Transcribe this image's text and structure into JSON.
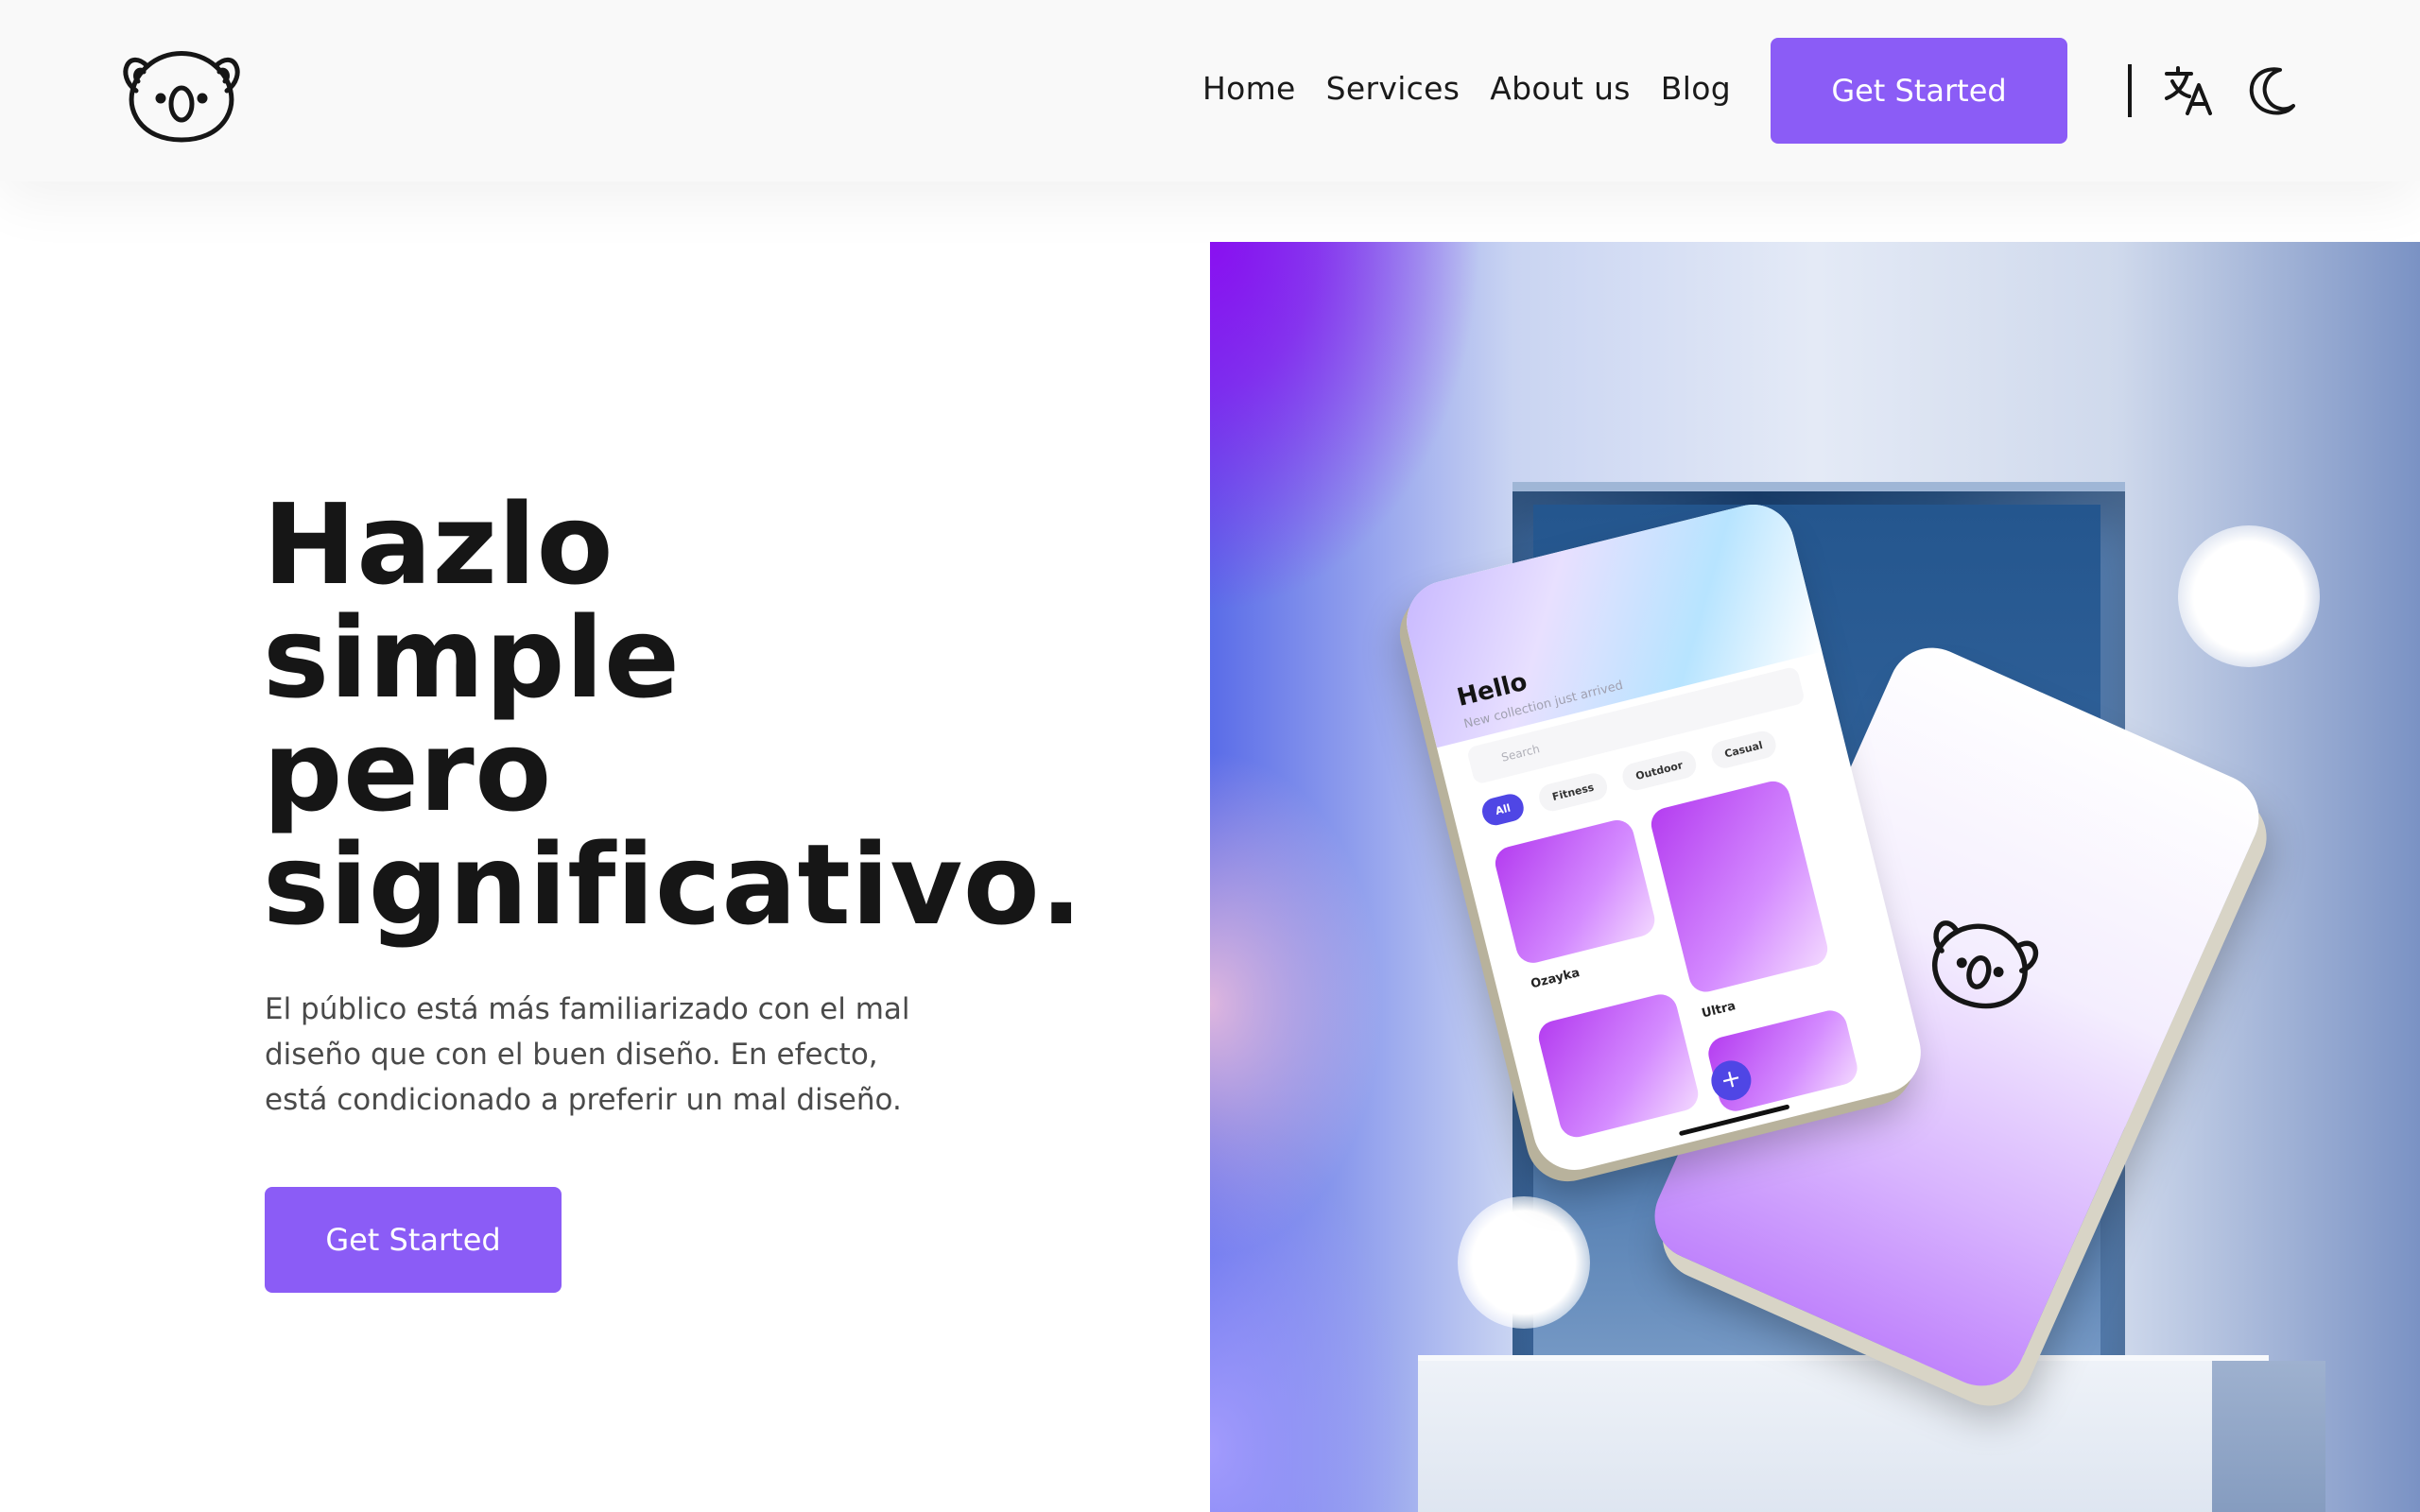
{
  "brand": {
    "logo_icon": "koala-icon"
  },
  "nav": {
    "items": [
      {
        "label": "Home"
      },
      {
        "label": "Services"
      },
      {
        "label": "About us"
      },
      {
        "label": "Blog"
      }
    ],
    "cta_label": "Get Started",
    "language_icon": "translate-icon",
    "theme_icon": "moon-icon"
  },
  "hero": {
    "title_lines": [
      "Hazlo",
      "simple",
      "pero",
      "significativo."
    ],
    "description_lines": [
      "El público está más familiarizado con el mal",
      "diseño que con el buen diseño. En efecto,",
      "está condicionado a preferir un mal diseño."
    ],
    "cta_label": "Get Started"
  },
  "mockup": {
    "greeting": "Hello",
    "subtitle": "New collection just arrived",
    "search_placeholder": "Search",
    "chips": [
      "All",
      "Fitness",
      "Outdoor",
      "Casual"
    ],
    "card_labels": [
      "Ozayka",
      "Ultra"
    ],
    "plus": "+"
  },
  "colors": {
    "accent": "#8b5cf6",
    "text": "#161616",
    "header_bg": "#f9f9f9"
  }
}
